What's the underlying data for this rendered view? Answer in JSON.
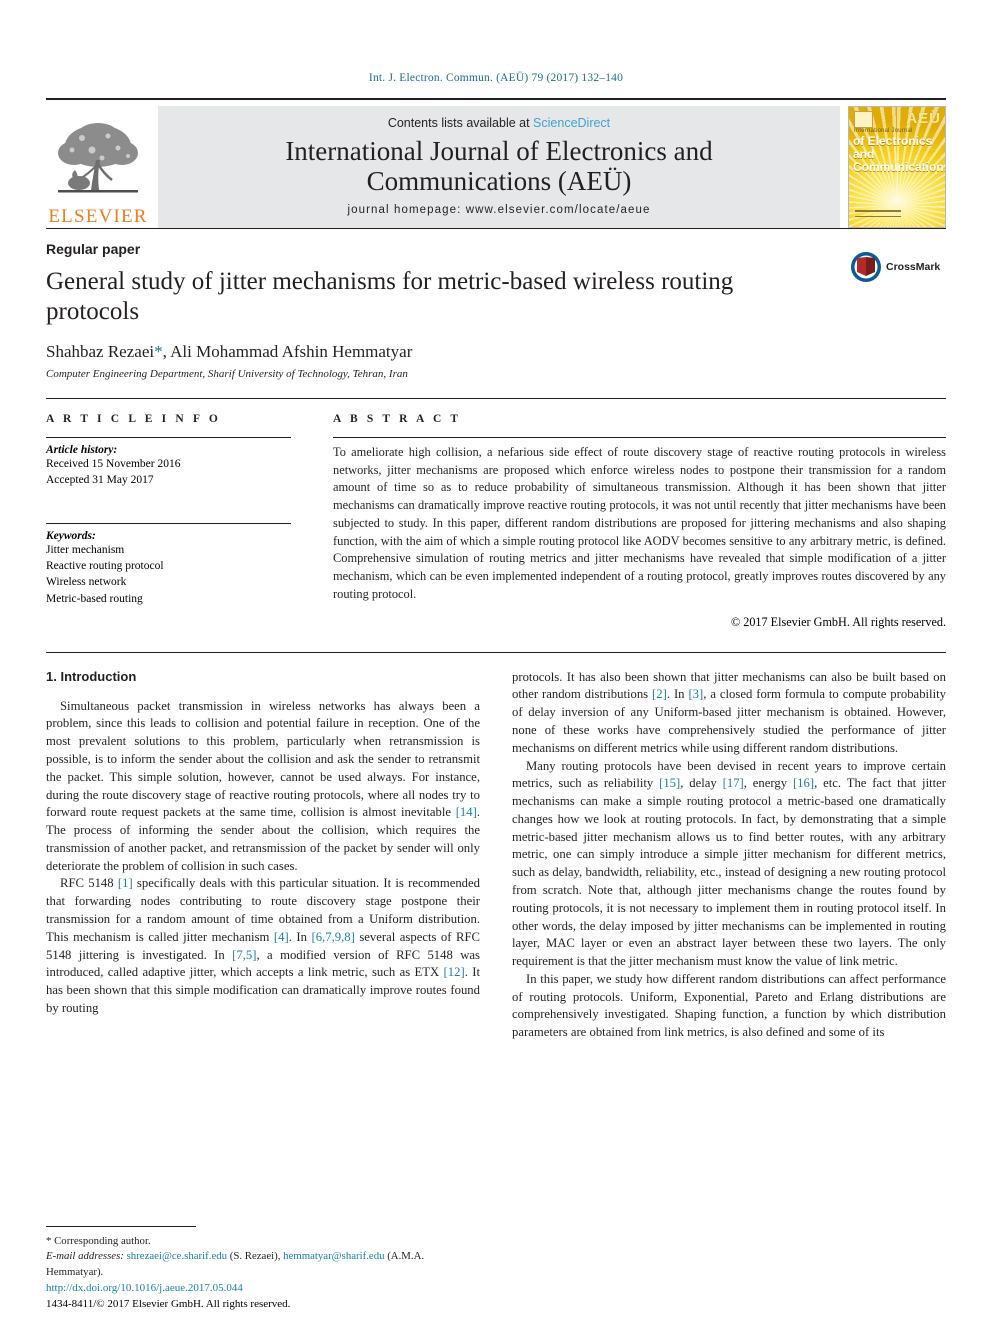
{
  "running_head": "Int. J. Electron. Commun. (AEÜ) 79 (2017) 132–140",
  "masthead": {
    "publisher_name": "ELSEVIER",
    "contents_prefix": "Contents lists available at ",
    "contents_link": "ScienceDirect",
    "journal_title_line1": "International Journal of Electronics and",
    "journal_title_line2": "Communications (AEÜ)",
    "homepage": "journal homepage: www.elsevier.com/locate/aeue",
    "cover": {
      "aeu": "AEÜ",
      "small_label": "International Journal",
      "name_line1": "of Electronics and",
      "name_line2": "Communications"
    }
  },
  "title_block": {
    "paper_type": "Regular paper",
    "title": "General study of jitter mechanisms for metric-based wireless routing protocols",
    "authors": "Shahbaz Rezaei",
    "author_star": "*",
    "authors_rest": ", Ali Mohammad Afshin Hemmatyar",
    "affiliation": "Computer Engineering Department, Sharif University of Technology, Tehran, Iran",
    "crossmark_label": "CrossMark"
  },
  "article_info": {
    "heading": "A R T I C L E   I N F O",
    "history_label": "Article history:",
    "received": "Received 15 November 2016",
    "accepted": "Accepted 31 May 2017",
    "keywords_label": "Keywords:",
    "keywords": [
      "Jitter mechanism",
      "Reactive routing protocol",
      "Wireless network",
      "Metric-based routing"
    ]
  },
  "abstract": {
    "heading": "A B S T R A C T",
    "text": "To ameliorate high collision, a nefarious side effect of route discovery stage of reactive routing protocols in wireless networks, jitter mechanisms are proposed which enforce wireless nodes to postpone their transmission for a random amount of time so as to reduce probability of simultaneous transmission. Although it has been shown that jitter mechanisms can dramatically improve reactive routing protocols, it was not until recently that jitter mechanisms have been subjected to study. In this paper, different random distributions are proposed for jittering mechanisms and also shaping function, with the aim of which a simple routing protocol like AODV becomes sensitive to any arbitrary metric, is defined. Comprehensive simulation of routing metrics and jitter mechanisms have revealed that simple modification of a jitter mechanism, which can be even implemented independent of a routing protocol, greatly improves routes discovered by any routing protocol.",
    "copyright": "© 2017 Elsevier GmbH. All rights reserved."
  },
  "body": {
    "section_title": "1. Introduction",
    "left_paragraphs": [
      "Simultaneous packet transmission in wireless networks has always been a problem, since this leads to collision and potential failure in reception. One of the most prevalent solutions to this problem, particularly when retransmission is possible, is to inform the sender about the collision and ask the sender to retransmit the packet. This simple solution, however, cannot be used always. For instance, during the route discovery stage of reactive routing protocols, where all nodes try to forward route request packets at the same time, collision is almost inevitable [14]. The process of informing the sender about the collision, which requires the transmission of another packet, and retransmission of the packet by sender will only deteriorate the problem of collision in such cases.",
      "RFC 5148 [1] specifically deals with this particular situation. It is recommended that forwarding nodes contributing to route discovery stage postpone their transmission for a random amount of time obtained from a Uniform distribution. This mechanism is called jitter mechanism [4]. In [6,7,9,8] several aspects of RFC 5148 jittering is investigated. In [7,5], a modified version of RFC 5148 was introduced, called adaptive jitter, which accepts a link metric, such as ETX [12]. It has been shown that this simple modification can dramatically improve routes found by routing"
    ],
    "right_paragraphs": [
      "protocols. It has also been shown that jitter mechanisms can also be built based on other random distributions [2]. In [3], a closed form formula to compute probability of delay inversion of any Uniform-based jitter mechanism is obtained. However, none of these works have comprehensively studied the performance of jitter mechanisms on different metrics while using different random distributions.",
      "Many routing protocols have been devised in recent years to improve certain metrics, such as reliability [15], delay [17], energy [16], etc. The fact that jitter mechanisms can make a simple routing protocol a metric-based one dramatically changes how we look at routing protocols. In fact, by demonstrating that a simple metric-based jitter mechanism allows us to find better routes, with any arbitrary metric, one can simply introduce a simple jitter mechanism for different metrics, such as delay, bandwidth, reliability, etc., instead of designing a new routing protocol from scratch. Note that, although jitter mechanisms change the routes found by routing protocols, it is not necessary to implement them in routing protocol itself. In other words, the delay imposed by jitter mechanisms can be implemented in routing layer, MAC layer or even an abstract layer between these two layers. The only requirement is that the jitter mechanism must know the value of link metric.",
      "In this paper, we study how different random distributions can affect performance of routing protocols. Uniform, Exponential, Pareto and Erlang distributions are comprehensively investigated. Shaping function, a function by which distribution parameters are obtained from link metrics, is also defined and some of its"
    ]
  },
  "footnote": {
    "corresponding": "* Corresponding author.",
    "email_label": "E-mail addresses:",
    "email1": "shrezaei@ce.sharif.edu",
    "email1_name": " (S. Rezaei), ",
    "email2": "hemmatyar@sharif.edu",
    "email2_name": " (A.M.A. Hemmatyar)."
  },
  "doi_block": {
    "doi": "http://dx.doi.org/10.1016/j.aeue.2017.05.044",
    "issn_line": "1434-8411/© 2017 Elsevier GmbH. All rights reserved."
  },
  "colors": {
    "link": "#1a7fa8",
    "elsevier_orange": "#ef7d22",
    "masthead_gray": "#e6e7e8",
    "cover_gold": "#f3c613"
  }
}
